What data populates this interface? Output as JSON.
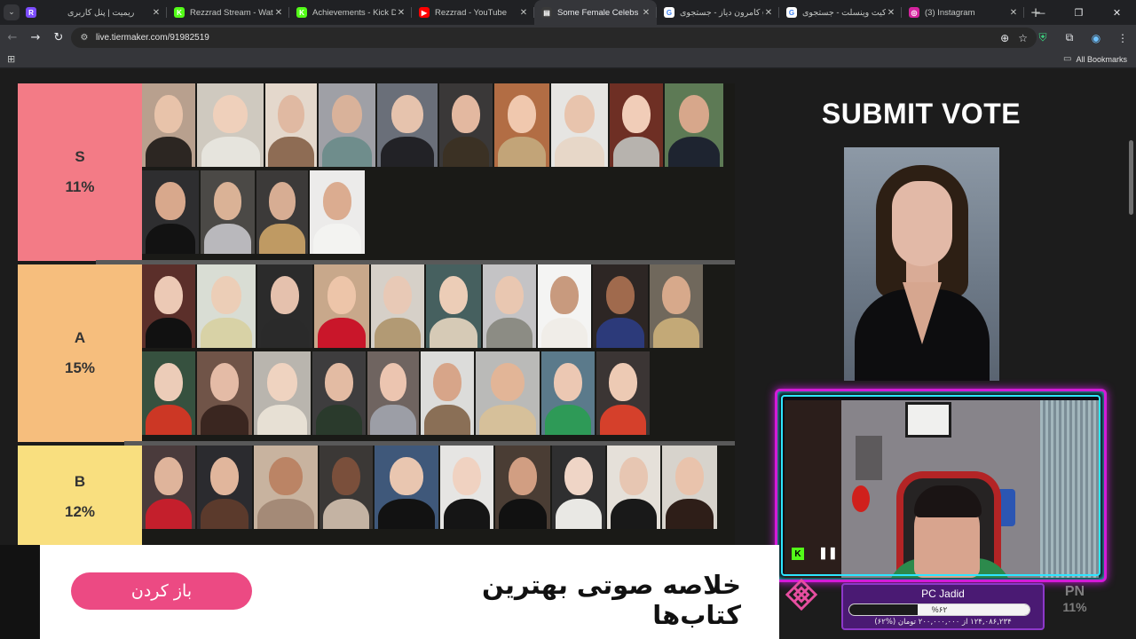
{
  "browser": {
    "tabs": [
      {
        "title": "",
        "favicon_color": "#7c4dff",
        "favicon_text": "R",
        "pinned": true
      },
      {
        "title": "ریمیت | پنل کاربری",
        "favicon_color": "#202124",
        "favicon_text": ""
      },
      {
        "title": "Rezzrad Stream - Watch L",
        "favicon_color": "#53fc18",
        "favicon_text": "K"
      },
      {
        "title": "Achievements - Kick Dash",
        "favicon_color": "#53fc18",
        "favicon_text": "K"
      },
      {
        "title": "Rezzrad - YouTube",
        "favicon_color": "#ff0000",
        "favicon_text": "▶"
      },
      {
        "title": "Some Female Celebs",
        "favicon_color": "#3a3a3a",
        "favicon_text": "▤",
        "active": true
      },
      {
        "title": "کامرون دیاز - جستجوی gle",
        "favicon_color": "#ffffff",
        "favicon_text": "G"
      },
      {
        "title": "کیت وینسلت - جستجوی gle",
        "favicon_color": "#ffffff",
        "favicon_text": "G"
      },
      {
        "title": "(3) Instagram",
        "favicon_color": "#d6249f",
        "favicon_text": "◎"
      }
    ],
    "url": "live.tiermaker.com/91982519",
    "all_bookmarks": "All Bookmarks"
  },
  "tiers": [
    {
      "letter": "S",
      "percent": "11%",
      "color": "#f37b86",
      "photos": [
        {
          "w": 60,
          "bg": "#b8a08e",
          "skin": "#e8c3aa",
          "dress": "#2c2622"
        },
        {
          "w": 75,
          "bg": "#cfc9bf",
          "skin": "#efd0bb",
          "dress": "#e6e4dd"
        },
        {
          "w": 58,
          "bg": "#e4d8cc",
          "skin": "#e0b9a2",
          "dress": "#8e6c54"
        },
        {
          "w": 64,
          "bg": "#9fa0a6",
          "skin": "#d9b29a",
          "dress": "#6f8d8c"
        },
        {
          "w": 68,
          "bg": "#6a6f79",
          "skin": "#e6c3ad",
          "dress": "#222226"
        },
        {
          "w": 60,
          "bg": "#3a3838",
          "skin": "#e3b8a0",
          "dress": "#3b3124"
        },
        {
          "w": 62,
          "bg": "#b26d44",
          "skin": "#f0c8ae",
          "dress": "#c2a478"
        },
        {
          "w": 64,
          "bg": "#e6e5e2",
          "skin": "#e8c4ad",
          "dress": "#e7d7c8"
        },
        {
          "w": 60,
          "bg": "#6e2f24",
          "skin": "#f1cdb8",
          "dress": "#b7b3ae"
        },
        {
          "w": 66,
          "bg": "#5d7a55",
          "skin": "#d7a78b",
          "dress": "#1e2430"
        },
        {
          "w": 64,
          "bg": "#2e2e30",
          "skin": "#d8a88c",
          "dress": "#121212"
        },
        {
          "w": 61,
          "bg": "#4b4946",
          "skin": "#dab296",
          "dress": "#b9b8bc"
        },
        {
          "w": 58,
          "bg": "#3c3a39",
          "skin": "#d7ad93",
          "dress": "#bf9a63"
        },
        {
          "w": 62,
          "bg": "#ecebea",
          "skin": "#dbac90",
          "dress": "#f3f3f1"
        }
      ]
    },
    {
      "letter": "A",
      "percent": "15%",
      "color": "#f6be7d",
      "photos": [
        {
          "w": 60,
          "bg": "#5b2f2a",
          "skin": "#ecc9b5",
          "dress": "#111111"
        },
        {
          "w": 66,
          "bg": "#d9ddd4",
          "skin": "#ecceb7",
          "dress": "#d8d2a6"
        },
        {
          "w": 62,
          "bg": "#2b2b2b",
          "skin": "#e5c1ad",
          "dress": "#2a2a2a"
        },
        {
          "w": 62,
          "bg": "#c8a88b",
          "skin": "#edc5a9",
          "dress": "#c9162a"
        },
        {
          "w": 60,
          "bg": "#d6d0c8",
          "skin": "#e8c9b6",
          "dress": "#b29a74"
        },
        {
          "w": 62,
          "bg": "#46605f",
          "skin": "#eccdb7",
          "dress": "#d6cab6"
        },
        {
          "w": 60,
          "bg": "#c4c3c5",
          "skin": "#e9c7b1",
          "dress": "#8c8c84"
        },
        {
          "w": 60,
          "bg": "#f4f4f3",
          "skin": "#c89a7e",
          "dress": "#f0ede8"
        },
        {
          "w": 62,
          "bg": "#2d2624",
          "skin": "#a06a4d",
          "dress": "#2c3a7a"
        },
        {
          "w": 60,
          "bg": "#70685c",
          "skin": "#d7a98b",
          "dress": "#c3a977"
        },
        {
          "w": 60,
          "bg": "#36513f",
          "skin": "#ecccb8",
          "dress": "#cc3725"
        },
        {
          "w": 62,
          "bg": "#705448",
          "skin": "#e4bba6",
          "dress": "#3a2620"
        },
        {
          "w": 64,
          "bg": "#b9b5ae",
          "skin": "#efd3c0",
          "dress": "#e7e0d4"
        },
        {
          "w": 60,
          "bg": "#3e3d3e",
          "skin": "#e3bba3",
          "dress": "#2a3a2c"
        },
        {
          "w": 58,
          "bg": "#6f6460",
          "skin": "#ecc5b0",
          "dress": "#9c9ea6"
        },
        {
          "w": 60,
          "bg": "#dcdcda",
          "skin": "#d7a589",
          "dress": "#8a6f56"
        },
        {
          "w": 72,
          "bg": "#babab8",
          "skin": "#e2b597",
          "dress": "#d6c09a"
        },
        {
          "w": 60,
          "bg": "#5b7a8b",
          "skin": "#ecc8b3",
          "dress": "#2e9a57"
        },
        {
          "w": 60,
          "bg": "#3b3534",
          "skin": "#edcab4",
          "dress": "#d5402b"
        }
      ]
    },
    {
      "letter": "B",
      "percent": "12%",
      "color": "#f9df7f",
      "photos": [
        {
          "w": 60,
          "bg": "#4a3b3c",
          "skin": "#dfb49b",
          "dress": "#c41f2c"
        },
        {
          "w": 62,
          "bg": "#2b2b2f",
          "skin": "#e1b69c",
          "dress": "#5b3a2c"
        },
        {
          "w": 72,
          "bg": "#c8b39f",
          "skin": "#bb8465",
          "dress": "#a48a77"
        },
        {
          "w": 60,
          "bg": "#3b3836",
          "skin": "#7a4f3b",
          "dress": "#c4b3a3"
        },
        {
          "w": 72,
          "bg": "#3f587a",
          "skin": "#e9c6b0",
          "dress": "#121212"
        },
        {
          "w": 60,
          "bg": "#e6e5e3",
          "skin": "#f0d2c1",
          "dress": "#151515"
        },
        {
          "w": 62,
          "bg": "#4a3d34",
          "skin": "#d19e82",
          "dress": "#111111"
        },
        {
          "w": 60,
          "bg": "#2f2f30",
          "skin": "#efd5c6",
          "dress": "#e9e8e4"
        },
        {
          "w": 60,
          "bg": "#e5e0d9",
          "skin": "#e7c6b2",
          "dress": "#191919"
        },
        {
          "w": 62,
          "bg": "#d7d3cc",
          "skin": "#e9c3ac",
          "dress": "#2e1e18"
        }
      ]
    }
  ],
  "vote_title": "SUBMIT VOTE",
  "ad": {
    "button_label": "باز کردن",
    "headline": "خلاصه صوتی بهترین کتاب‌ها"
  },
  "stream_goal": {
    "name": "PC Jadid",
    "percent_label": "%۶۲",
    "progress": 0.62,
    "description": "۱۲۴,۰۸۶,۲۳۴ از ۲۰۰,۰۰۰,۰۰۰ تومان (%۶۲)"
  },
  "ghost_tier": {
    "letter": "PN",
    "percent": "11%"
  }
}
